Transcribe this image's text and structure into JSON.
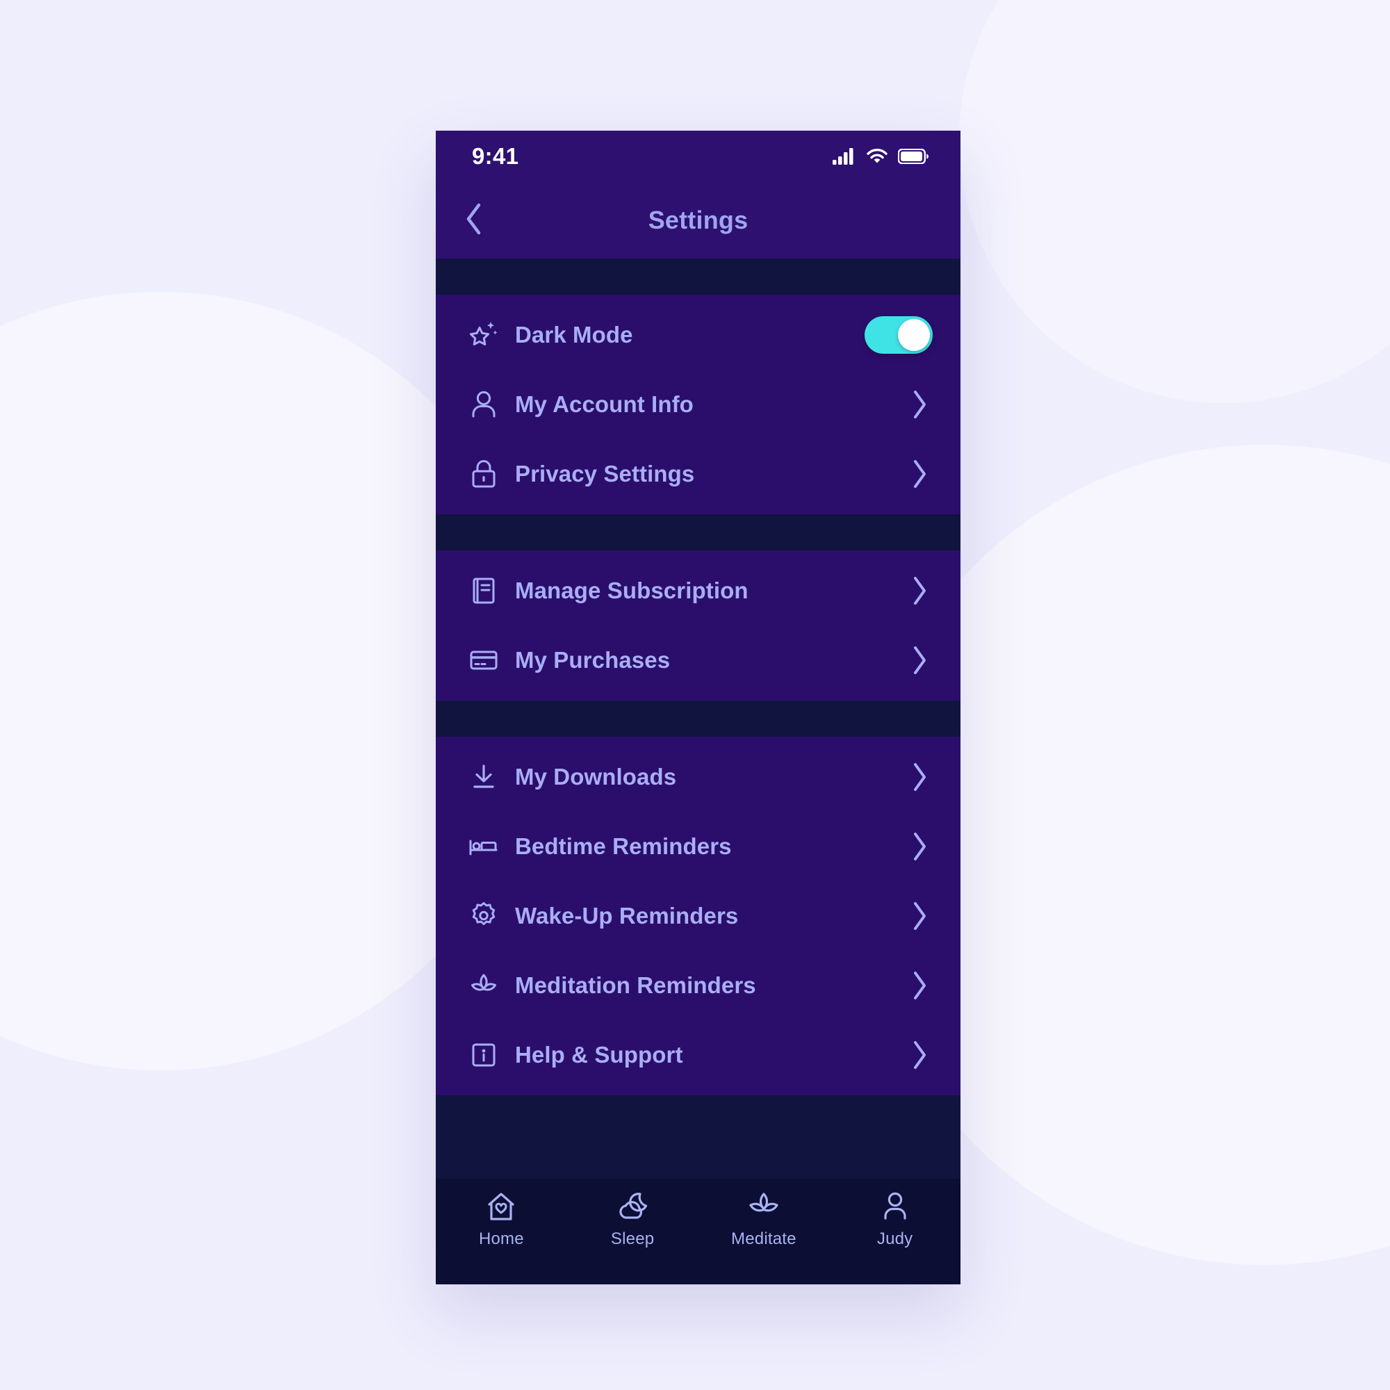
{
  "theme": {
    "page_background": "#EFEEFD",
    "phone_background": "#121440",
    "header_purple": "#2E1070",
    "section_purple": "#2B0E6B",
    "tabbar_navy": "#0C0E33",
    "label_color": "#A9AEF5",
    "title_color": "#9FA5F0",
    "accent_cyan": "#3FE3E6"
  },
  "status_bar": {
    "time": "9:41",
    "signal_icon": "cellular-signal-icon",
    "wifi_icon": "wifi-icon",
    "battery_icon": "battery-icon"
  },
  "nav": {
    "back_icon": "chevron-left-icon",
    "title": "Settings"
  },
  "sections": [
    {
      "id": "account",
      "rows": [
        {
          "label": "Dark Mode",
          "icon": "star-sparkle-icon",
          "control": "toggle",
          "toggle_on": true
        },
        {
          "label": "My Account Info",
          "icon": "person-icon",
          "control": "chevron"
        },
        {
          "label": "Privacy Settings",
          "icon": "lock-icon",
          "control": "chevron"
        }
      ]
    },
    {
      "id": "billing",
      "rows": [
        {
          "label": "Manage Subscription",
          "icon": "book-icon",
          "control": "chevron"
        },
        {
          "label": "My Purchases",
          "icon": "credit-card-icon",
          "control": "chevron"
        }
      ]
    },
    {
      "id": "content-reminders",
      "rows": [
        {
          "label": "My Downloads",
          "icon": "download-icon",
          "control": "chevron"
        },
        {
          "label": "Bedtime Reminders",
          "icon": "bed-icon",
          "control": "chevron"
        },
        {
          "label": "Wake-Up Reminders",
          "icon": "sun-icon",
          "control": "chevron"
        },
        {
          "label": "Meditation Reminders",
          "icon": "lotus-icon",
          "control": "chevron"
        },
        {
          "label": "Help & Support",
          "icon": "help-box-icon",
          "control": "chevron"
        }
      ]
    }
  ],
  "tabbar": {
    "tabs": [
      {
        "label": "Home",
        "icon": "house-heart-icon"
      },
      {
        "label": "Sleep",
        "icon": "cloud-moon-icon"
      },
      {
        "label": "Meditate",
        "icon": "lotus-icon"
      },
      {
        "label": "Judy",
        "icon": "person-icon"
      }
    ]
  }
}
